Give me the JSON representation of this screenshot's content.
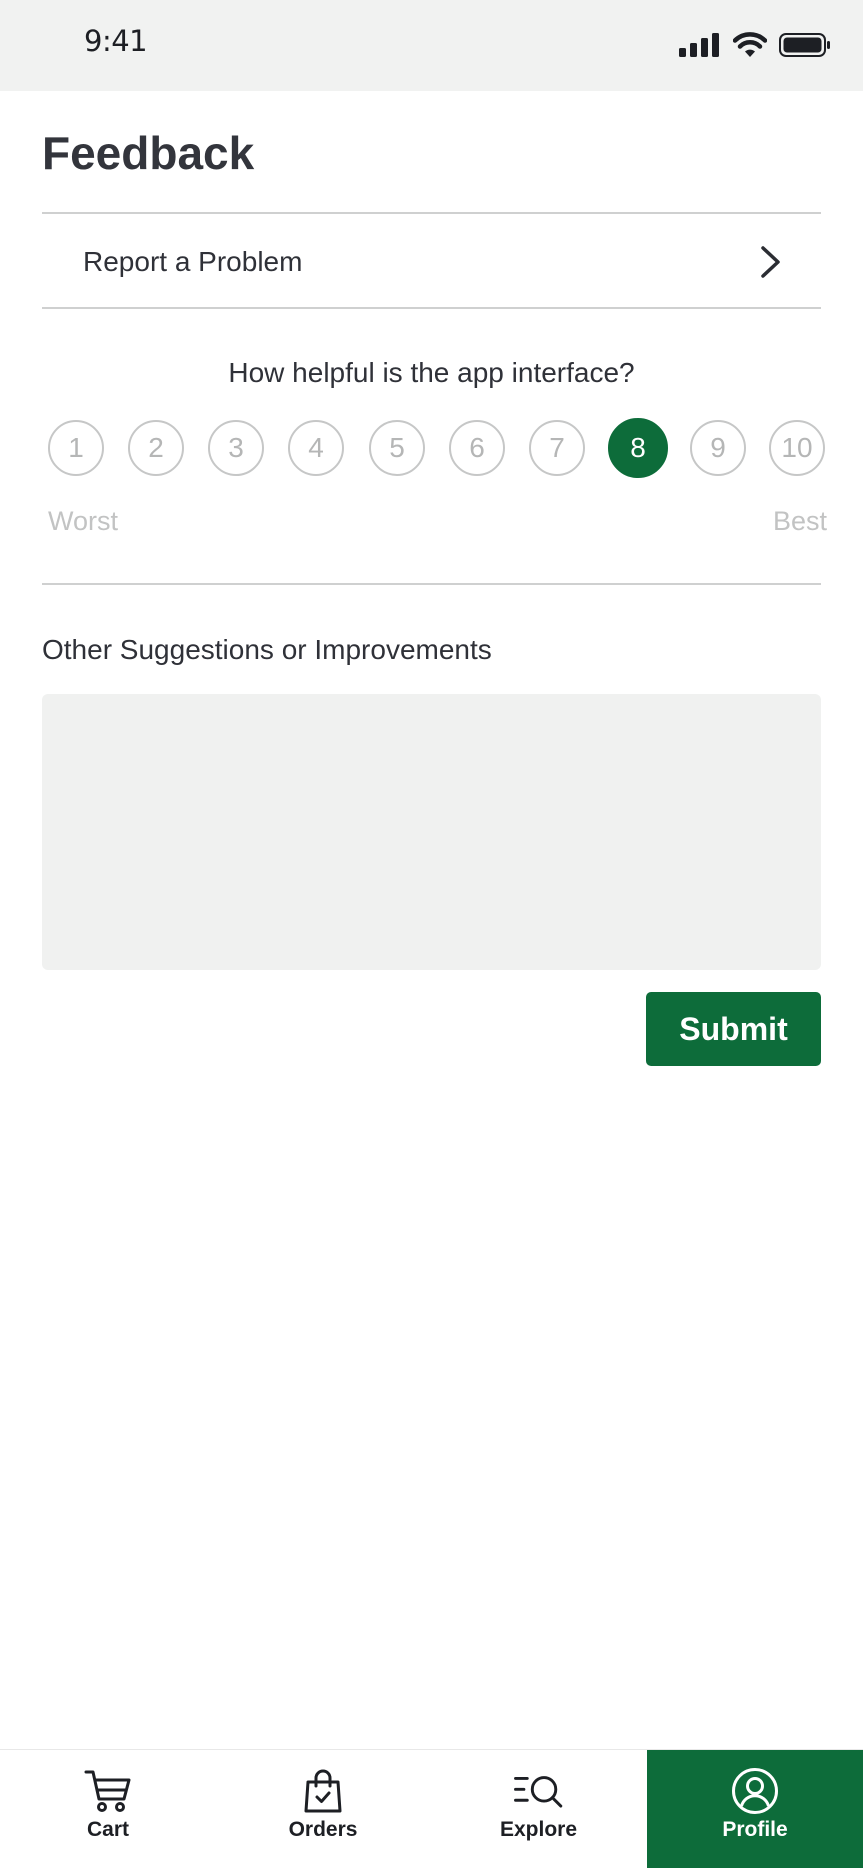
{
  "status_bar": {
    "time": "9:41"
  },
  "header": {
    "title": "Feedback"
  },
  "report": {
    "label": "Report a Problem"
  },
  "rating": {
    "question": "How helpful is the app interface?",
    "options": [
      "1",
      "2",
      "3",
      "4",
      "5",
      "6",
      "7",
      "8",
      "9",
      "10"
    ],
    "selected": "8",
    "min_label": "Worst",
    "max_label": "Best"
  },
  "suggestions": {
    "label": "Other Suggestions or Improvements",
    "value": "",
    "placeholder": ""
  },
  "submit": {
    "label": "Submit"
  },
  "bottom_nav": {
    "items": [
      {
        "label": "Cart",
        "icon": "cart-icon"
      },
      {
        "label": "Orders",
        "icon": "shopping-bag-icon"
      },
      {
        "label": "Explore",
        "icon": "explore-search-icon"
      },
      {
        "label": "Profile",
        "icon": "user-circle-icon"
      }
    ],
    "active": "Profile"
  },
  "colors": {
    "accent": "#0d6c3a",
    "status_bar_bg": "#f1f2f1",
    "input_bg": "#f0f1f0",
    "text_primary": "#2f3138",
    "text_muted": "#c2c3c3"
  }
}
